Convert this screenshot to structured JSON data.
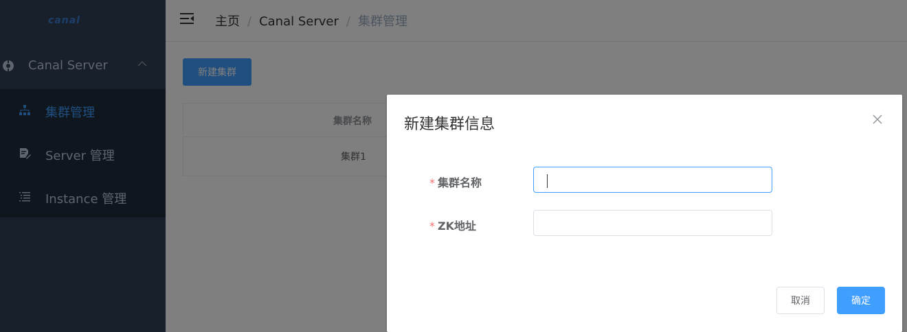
{
  "app": {
    "logo_text": "canal"
  },
  "sidebar": {
    "parent": {
      "label": "Canal Server",
      "icon": "server-icon"
    },
    "items": [
      {
        "label": "集群管理",
        "icon": "sitemap-icon",
        "active": true
      },
      {
        "label": "Server 管理",
        "icon": "document-edit-icon",
        "active": false
      },
      {
        "label": "Instance 管理",
        "icon": "list-icon",
        "active": false
      }
    ]
  },
  "header": {
    "breadcrumb": [
      "主页",
      "Canal Server",
      "集群管理"
    ],
    "separator": "/"
  },
  "main": {
    "create_button": "新建集群",
    "table": {
      "columns": [
        "集群名称"
      ],
      "rows": [
        [
          "集群1"
        ]
      ]
    }
  },
  "dialog": {
    "title": "新建集群信息",
    "required_mark": "*",
    "fields": [
      {
        "label": "集群名称",
        "value": "",
        "focused": true
      },
      {
        "label": "ZK地址",
        "value": "",
        "focused": false
      }
    ],
    "cancel": "取消",
    "confirm": "确定"
  },
  "colors": {
    "primary": "#409eff",
    "sidebar_bg": "#304156",
    "submenu_bg": "#1f2d3d",
    "required": "#f56c6c"
  }
}
